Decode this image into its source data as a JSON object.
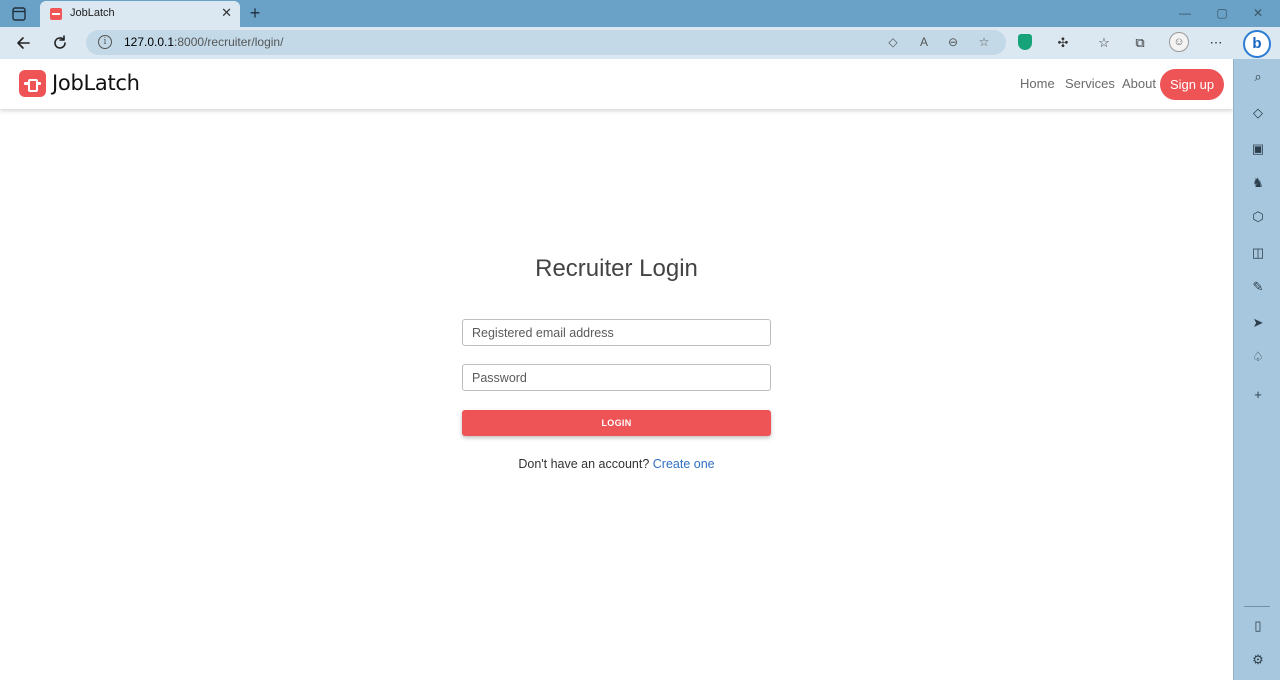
{
  "browser": {
    "tab_title": "JobLatch",
    "tab_close": "✕",
    "new_tab": "+",
    "url_host": "127.0.0.1",
    "url_path": ":8000/recruiter/login/",
    "window_controls": {
      "minimize": "—",
      "maximize": "▢",
      "close": "✕"
    }
  },
  "site": {
    "brand": "JobLatch",
    "nav": {
      "home": "Home",
      "services": "Services",
      "about": "About",
      "signup": "Sign up"
    }
  },
  "login": {
    "title": "Recruiter Login",
    "email_placeholder": "Registered email address",
    "email_value": "",
    "password_placeholder": "Password",
    "password_value": "",
    "submit_label": "LOGIN",
    "prompt_text": "Don't have an account?",
    "create_link": "Create one"
  },
  "colors": {
    "accent": "#ee5356",
    "link": "#2f6fc4",
    "browser_frame": "#6aa1c6",
    "toolbar": "#dbe8f2",
    "sidebar": "#a6c7dd"
  },
  "icons": {
    "sidebar": [
      "search-icon",
      "tag-icon",
      "toolbox-icon",
      "chess-icon",
      "copilot-icon",
      "outlook-icon",
      "drop-icon",
      "send-icon",
      "tree-icon",
      "add-icon",
      "panel-icon",
      "settings-icon"
    ]
  }
}
